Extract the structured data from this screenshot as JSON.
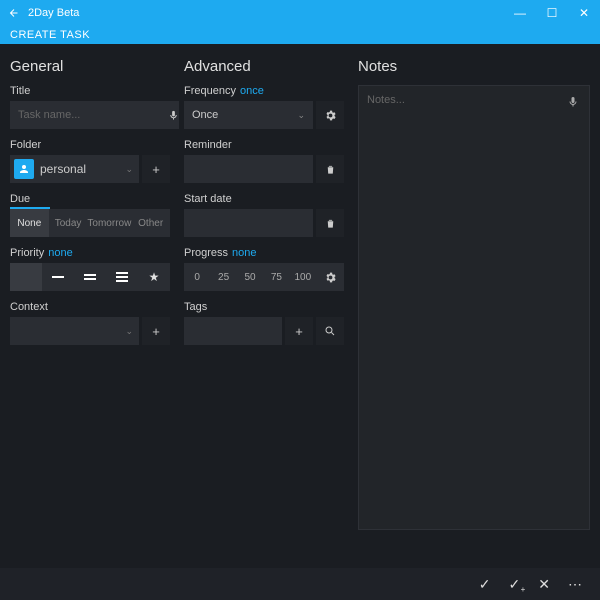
{
  "app": {
    "title": "2Day Beta",
    "subtitle": "CREATE TASK"
  },
  "general": {
    "heading": "General",
    "title_label": "Title",
    "title_placeholder": "Task name...",
    "folder_label": "Folder",
    "folder_value": "personal",
    "due_label": "Due",
    "due_options": [
      "None",
      "Today",
      "Tomorrow",
      "Other"
    ],
    "due_selected": "None",
    "priority_label": "Priority",
    "priority_value": "none",
    "context_label": "Context"
  },
  "advanced": {
    "heading": "Advanced",
    "frequency_label": "Frequency",
    "frequency_value": "once",
    "frequency_select": "Once",
    "reminder_label": "Reminder",
    "startdate_label": "Start date",
    "progress_label": "Progress",
    "progress_value": "none",
    "progress_steps": [
      "0",
      "25",
      "50",
      "75",
      "100"
    ],
    "tags_label": "Tags"
  },
  "notes": {
    "heading": "Notes",
    "placeholder": "Notes..."
  }
}
